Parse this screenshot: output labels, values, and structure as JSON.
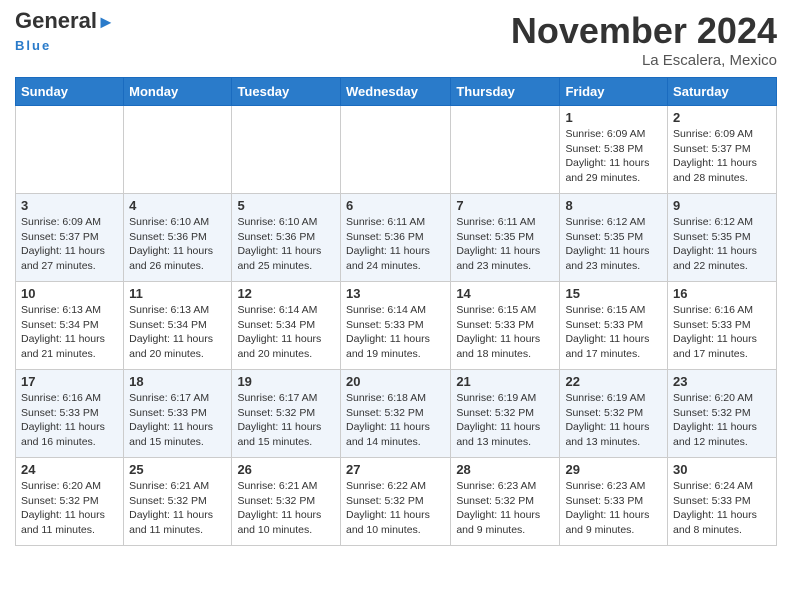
{
  "header": {
    "logo_general": "General",
    "logo_blue": "Blue",
    "logo_subtitle": "Blue",
    "month_title": "November 2024",
    "location": "La Escalera, Mexico"
  },
  "weekdays": [
    "Sunday",
    "Monday",
    "Tuesday",
    "Wednesday",
    "Thursday",
    "Friday",
    "Saturday"
  ],
  "weeks": [
    [
      {
        "day": "",
        "info": ""
      },
      {
        "day": "",
        "info": ""
      },
      {
        "day": "",
        "info": ""
      },
      {
        "day": "",
        "info": ""
      },
      {
        "day": "",
        "info": ""
      },
      {
        "day": "1",
        "info": "Sunrise: 6:09 AM\nSunset: 5:38 PM\nDaylight: 11 hours and 29 minutes."
      },
      {
        "day": "2",
        "info": "Sunrise: 6:09 AM\nSunset: 5:37 PM\nDaylight: 11 hours and 28 minutes."
      }
    ],
    [
      {
        "day": "3",
        "info": "Sunrise: 6:09 AM\nSunset: 5:37 PM\nDaylight: 11 hours and 27 minutes."
      },
      {
        "day": "4",
        "info": "Sunrise: 6:10 AM\nSunset: 5:36 PM\nDaylight: 11 hours and 26 minutes."
      },
      {
        "day": "5",
        "info": "Sunrise: 6:10 AM\nSunset: 5:36 PM\nDaylight: 11 hours and 25 minutes."
      },
      {
        "day": "6",
        "info": "Sunrise: 6:11 AM\nSunset: 5:36 PM\nDaylight: 11 hours and 24 minutes."
      },
      {
        "day": "7",
        "info": "Sunrise: 6:11 AM\nSunset: 5:35 PM\nDaylight: 11 hours and 23 minutes."
      },
      {
        "day": "8",
        "info": "Sunrise: 6:12 AM\nSunset: 5:35 PM\nDaylight: 11 hours and 23 minutes."
      },
      {
        "day": "9",
        "info": "Sunrise: 6:12 AM\nSunset: 5:35 PM\nDaylight: 11 hours and 22 minutes."
      }
    ],
    [
      {
        "day": "10",
        "info": "Sunrise: 6:13 AM\nSunset: 5:34 PM\nDaylight: 11 hours and 21 minutes."
      },
      {
        "day": "11",
        "info": "Sunrise: 6:13 AM\nSunset: 5:34 PM\nDaylight: 11 hours and 20 minutes."
      },
      {
        "day": "12",
        "info": "Sunrise: 6:14 AM\nSunset: 5:34 PM\nDaylight: 11 hours and 20 minutes."
      },
      {
        "day": "13",
        "info": "Sunrise: 6:14 AM\nSunset: 5:33 PM\nDaylight: 11 hours and 19 minutes."
      },
      {
        "day": "14",
        "info": "Sunrise: 6:15 AM\nSunset: 5:33 PM\nDaylight: 11 hours and 18 minutes."
      },
      {
        "day": "15",
        "info": "Sunrise: 6:15 AM\nSunset: 5:33 PM\nDaylight: 11 hours and 17 minutes."
      },
      {
        "day": "16",
        "info": "Sunrise: 6:16 AM\nSunset: 5:33 PM\nDaylight: 11 hours and 17 minutes."
      }
    ],
    [
      {
        "day": "17",
        "info": "Sunrise: 6:16 AM\nSunset: 5:33 PM\nDaylight: 11 hours and 16 minutes."
      },
      {
        "day": "18",
        "info": "Sunrise: 6:17 AM\nSunset: 5:33 PM\nDaylight: 11 hours and 15 minutes."
      },
      {
        "day": "19",
        "info": "Sunrise: 6:17 AM\nSunset: 5:32 PM\nDaylight: 11 hours and 15 minutes."
      },
      {
        "day": "20",
        "info": "Sunrise: 6:18 AM\nSunset: 5:32 PM\nDaylight: 11 hours and 14 minutes."
      },
      {
        "day": "21",
        "info": "Sunrise: 6:19 AM\nSunset: 5:32 PM\nDaylight: 11 hours and 13 minutes."
      },
      {
        "day": "22",
        "info": "Sunrise: 6:19 AM\nSunset: 5:32 PM\nDaylight: 11 hours and 13 minutes."
      },
      {
        "day": "23",
        "info": "Sunrise: 6:20 AM\nSunset: 5:32 PM\nDaylight: 11 hours and 12 minutes."
      }
    ],
    [
      {
        "day": "24",
        "info": "Sunrise: 6:20 AM\nSunset: 5:32 PM\nDaylight: 11 hours and 11 minutes."
      },
      {
        "day": "25",
        "info": "Sunrise: 6:21 AM\nSunset: 5:32 PM\nDaylight: 11 hours and 11 minutes."
      },
      {
        "day": "26",
        "info": "Sunrise: 6:21 AM\nSunset: 5:32 PM\nDaylight: 11 hours and 10 minutes."
      },
      {
        "day": "27",
        "info": "Sunrise: 6:22 AM\nSunset: 5:32 PM\nDaylight: 11 hours and 10 minutes."
      },
      {
        "day": "28",
        "info": "Sunrise: 6:23 AM\nSunset: 5:32 PM\nDaylight: 11 hours and 9 minutes."
      },
      {
        "day": "29",
        "info": "Sunrise: 6:23 AM\nSunset: 5:33 PM\nDaylight: 11 hours and 9 minutes."
      },
      {
        "day": "30",
        "info": "Sunrise: 6:24 AM\nSunset: 5:33 PM\nDaylight: 11 hours and 8 minutes."
      }
    ]
  ]
}
